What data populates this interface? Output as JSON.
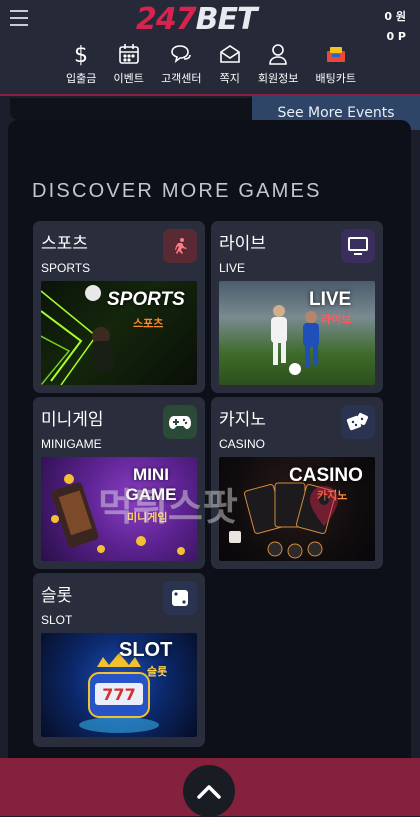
{
  "header": {
    "logo_num": "247",
    "logo_text": "BET",
    "balance_money": "0 원",
    "balance_points": "0 P"
  },
  "nav": [
    {
      "label": "입출금",
      "icon": "dollar-icon"
    },
    {
      "label": "이벤트",
      "icon": "calendar-icon"
    },
    {
      "label": "고객센터",
      "icon": "chat-icon"
    },
    {
      "label": "쪽지",
      "icon": "mail-icon"
    },
    {
      "label": "회원정보",
      "icon": "user-icon"
    },
    {
      "label": "배팅카트",
      "icon": "bet-cart-icon"
    }
  ],
  "events": {
    "see_more_label": "See More Events"
  },
  "games": {
    "section_title": "DISCOVER MORE GAMES",
    "cards": [
      {
        "title": "스포츠",
        "subtitle": "SPORTS",
        "icon": "running-icon",
        "img_title": "SPORTS",
        "img_sub": "스포츠",
        "icon_bg": "#5a2a34",
        "icon_color": "#ff6f7a"
      },
      {
        "title": "라이브",
        "subtitle": "LIVE",
        "icon": "monitor-icon",
        "img_title": "LIVE",
        "img_sub": "라이브",
        "icon_bg": "#3a2f5c",
        "icon_color": "#ffffff"
      },
      {
        "title": "미니게임",
        "subtitle": "MINIGAME",
        "icon": "gamepad-icon",
        "img_title": "MINI GAME",
        "img_sub": "미니게임",
        "icon_bg": "#2b4a37",
        "icon_color": "#ffffff"
      },
      {
        "title": "카지노",
        "subtitle": "CASINO",
        "icon": "dice-icon",
        "img_title": "CASINO",
        "img_sub": "카지노",
        "icon_bg": "#2a3450",
        "icon_color": "#ffffff"
      },
      {
        "title": "슬롯",
        "subtitle": "SLOT",
        "icon": "die-icon",
        "img_title": "SLOT",
        "img_sub": "슬롯",
        "icon_bg": "#2a3450",
        "icon_color": "#ffffff"
      }
    ]
  },
  "watermark": {
    "text": "먹튀스팟"
  }
}
